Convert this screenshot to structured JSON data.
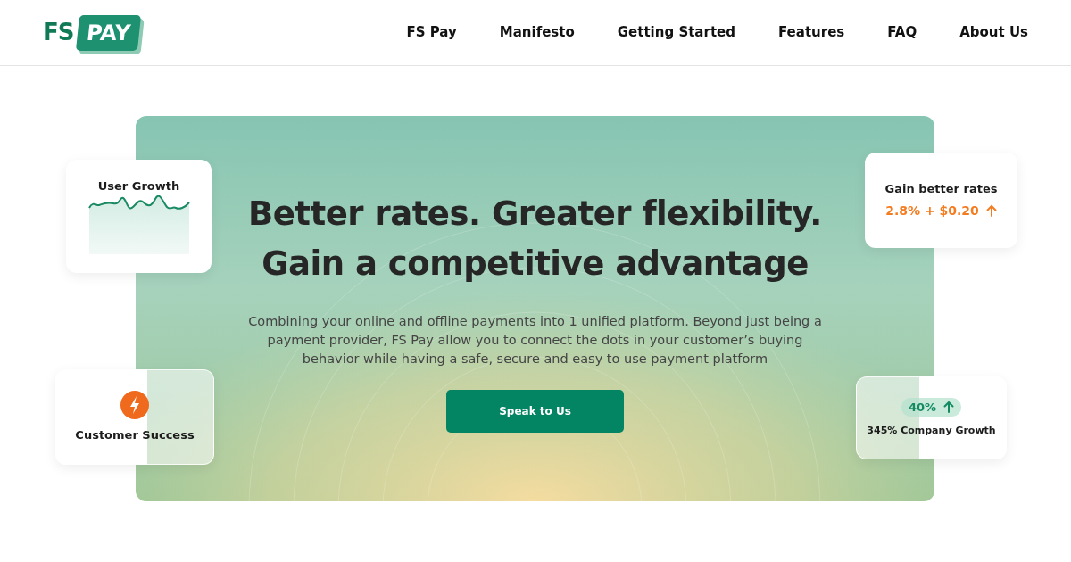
{
  "logo": {
    "prefix": "FS",
    "badge": "PAY"
  },
  "nav": [
    "FS Pay",
    "Manifesto",
    "Getting Started",
    "Features",
    "FAQ",
    "About Us"
  ],
  "hero": {
    "headline_lines": [
      "Better rates. Greater flexibility.",
      "Gain a competitive advantage"
    ],
    "description": "Combining your online and offline payments into 1 unified platform. Beyond just being a payment provider, FS Pay allow you to connect the dots in your customer’s buying behavior while having a safe, secure and easy to use payment platform",
    "button": "Speak to Us"
  },
  "cards": [
    {
      "kind": "sparkline",
      "title": "User Growth"
    },
    {
      "kind": "rate",
      "title": "Gain better rates",
      "value": "2.8% + $0.20"
    },
    {
      "kind": "icon",
      "title": "Customer Success"
    },
    {
      "kind": "growth",
      "value": "40%",
      "title": "345% Company Growth"
    }
  ]
}
